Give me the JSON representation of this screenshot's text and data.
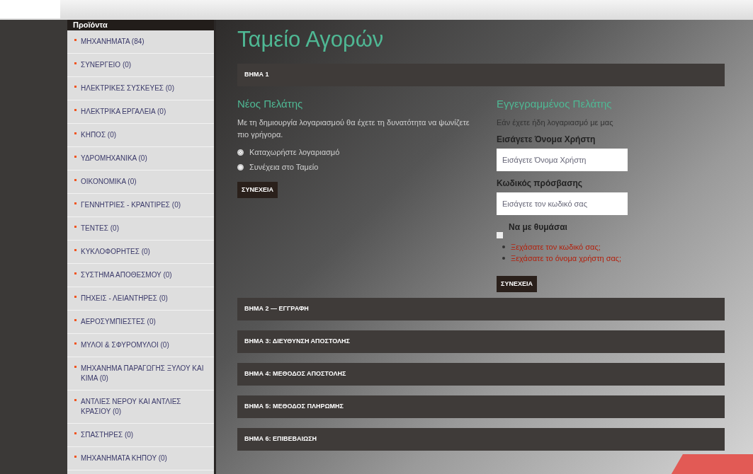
{
  "sidebar": {
    "title": "Προϊόντα",
    "items": [
      {
        "label": "ΜΗΧΑΝΗΜΑΤΑ (84)"
      },
      {
        "label": "ΣΥΝΕΡΓΕΙΟ (0)"
      },
      {
        "label": "ΗΛΕΚΤΡΙΚΕΣ ΣΥΣΚΕΥΕΣ (0)"
      },
      {
        "label": "ΗΛΕΚΤΡΙΚΑ ΕΡΓΑΛΕΙΑ (0)"
      },
      {
        "label": "ΚΗΠΟΣ (0)"
      },
      {
        "label": "ΥΔΡΟΜΗΧΑΝΙΚΑ (0)"
      },
      {
        "label": "ΟΙΚΟΝΟΜΙΚΑ (0)"
      },
      {
        "label": "ΓΕΝΝΗΤΡΙΕΣ - ΚΡΑΝΤΙΡΕΣ (0)"
      },
      {
        "label": "ΤΕΝΤΕΣ (0)"
      },
      {
        "label": "ΚΥΚΛΟΦΟΡΗΤΕΣ (0)"
      },
      {
        "label": "ΣΥΣΤΗΜΑ ΑΠΟΘΕΣΜΟΥ (0)"
      },
      {
        "label": "ΠΗΧΕΙΣ - ΛΕΙΑΝΤΗΡΕΣ (0)"
      },
      {
        "label": "ΑΕΡΟΣΥΜΠΙΕΣΤΕΣ (0)"
      },
      {
        "label": "ΜΥΛΟΙ & ΣΦΥΡΟΜΥΛΟΙ (0)"
      },
      {
        "label": "ΜΗΧΑΝΗΜΑ ΠΑΡΑΓΩΓΗΣ ΞΥΛΟΥ ΚΑΙ ΚΙΜΑ (0)"
      },
      {
        "label": "ΑΝΤΛΙΕΣ ΝΕΡΟΥ ΚΑΙ ΑΝΤΛΙΕΣ ΚΡΑΣΙΟΥ (0)"
      },
      {
        "label": "ΣΠΑΣΤΗΡΕΣ (0)"
      },
      {
        "label": "ΜΗΧΑΝΗΜΑΤΑ ΚΗΠΟΥ (0)"
      }
    ]
  },
  "page_title": "Ταμείο Αγορών",
  "step_1": "ΒΗΜΑ 1",
  "new_customer": {
    "heading": "Νέος Πελάτης",
    "text": "Με τη δημιουργία λογαριασμού θα έχετε τη δυνατότητα να ψωνίζετε πιο γρήγορα.",
    "options": [
      {
        "label": "Καταχωρήστε λογαριασμό",
        "selected": true
      },
      {
        "label": "Συνέχεια στο Ταμείο",
        "selected": false
      }
    ],
    "button": "ΣΥΝΕΧΕΙΑ"
  },
  "registered_customer": {
    "heading": "Εγγεγραμμένος Πελάτης",
    "text": "Εάν έχετε ήδη λογαριασμό με μας",
    "username_label": "Εισάγετε Όνομα Χρήστη",
    "username_placeholder": "Εισάγετε Όνομα Χρήστη",
    "password_label": "Κωδικός πρόσβασης",
    "password_placeholder": "Εισάγετε τον κωδικό σας",
    "remember": {
      "label": "Να με θυμάσαι",
      "checked": false
    },
    "links": [
      "Ξεχάσατε τον κωδικό σας;",
      "Ξεχάσατε το όνομα χρήστη σας;"
    ],
    "button": "ΣΥΝΕΧΕΙΑ"
  },
  "steps": [
    "ΒΗΜΑ 2 — ΕΓΓΡΑΦΗ",
    "ΒΗΜΑ 3: ΔΙΕΥΘΥΝΣΗ ΑΠΟΣΤΟΛΗΣ",
    "ΒΗΜΑ 4: ΜΕΘΟΔΟΣ ΑΠΟΣΤΟΛΗΣ",
    "ΒΗΜΑ 5: ΜΕΘΟΔΟΣ ΠΛΗΡΩΜΗΣ",
    "ΒΗΜΑ 6: ΕΠΙΒΕΒΑΙΩΣΗ"
  ]
}
